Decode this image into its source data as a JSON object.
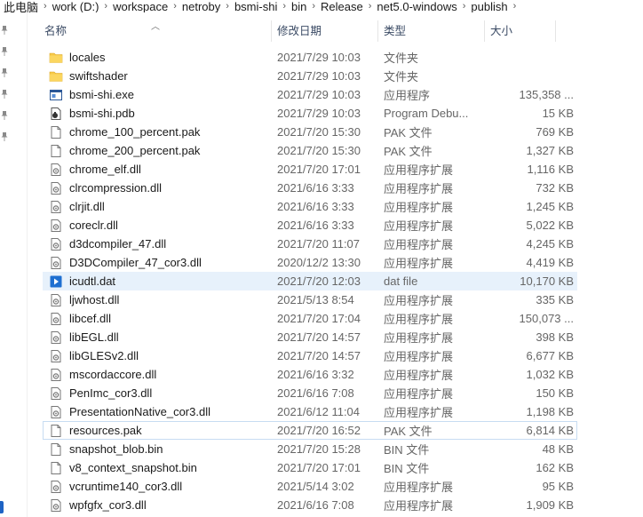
{
  "breadcrumb": [
    "此电脑",
    "work (D:)",
    "workspace",
    "netroby",
    "bsmi-shi",
    "bin",
    "Release",
    "net5.0-windows",
    "publish"
  ],
  "columns": {
    "name": "名称",
    "date": "修改日期",
    "type": "类型",
    "size": "大小"
  },
  "files": [
    {
      "name": "locales",
      "date": "2021/7/29 10:03",
      "type": "文件夹",
      "size": "",
      "icon": "folder-icon"
    },
    {
      "name": "swiftshader",
      "date": "2021/7/29 10:03",
      "type": "文件夹",
      "size": "",
      "icon": "folder-icon"
    },
    {
      "name": "bsmi-shi.exe",
      "date": "2021/7/29 10:03",
      "type": "应用程序",
      "size": "135,358 ...",
      "icon": "exe-icon"
    },
    {
      "name": "bsmi-shi.pdb",
      "date": "2021/7/29 10:03",
      "type": "Program Debu...",
      "size": "15 KB",
      "icon": "pdb-icon"
    },
    {
      "name": "chrome_100_percent.pak",
      "date": "2021/7/20 15:30",
      "type": "PAK 文件",
      "size": "769 KB",
      "icon": "file-icon"
    },
    {
      "name": "chrome_200_percent.pak",
      "date": "2021/7/20 15:30",
      "type": "PAK 文件",
      "size": "1,327 KB",
      "icon": "file-icon"
    },
    {
      "name": "chrome_elf.dll",
      "date": "2021/7/20 17:01",
      "type": "应用程序扩展",
      "size": "1,116 KB",
      "icon": "dll-icon"
    },
    {
      "name": "clrcompression.dll",
      "date": "2021/6/16 3:33",
      "type": "应用程序扩展",
      "size": "732 KB",
      "icon": "dll-icon"
    },
    {
      "name": "clrjit.dll",
      "date": "2021/6/16 3:33",
      "type": "应用程序扩展",
      "size": "1,245 KB",
      "icon": "dll-icon"
    },
    {
      "name": "coreclr.dll",
      "date": "2021/6/16 3:33",
      "type": "应用程序扩展",
      "size": "5,022 KB",
      "icon": "dll-icon"
    },
    {
      "name": "d3dcompiler_47.dll",
      "date": "2021/7/20 11:07",
      "type": "应用程序扩展",
      "size": "4,245 KB",
      "icon": "dll-icon"
    },
    {
      "name": "D3DCompiler_47_cor3.dll",
      "date": "2020/12/2 13:30",
      "type": "应用程序扩展",
      "size": "4,419 KB",
      "icon": "dll-icon"
    },
    {
      "name": "icudtl.dat",
      "date": "2021/7/20 12:03",
      "type": "dat file",
      "size": "10,170 KB",
      "icon": "dat-icon",
      "selected": true
    },
    {
      "name": "ljwhost.dll",
      "date": "2021/5/13 8:54",
      "type": "应用程序扩展",
      "size": "335 KB",
      "icon": "dll-icon"
    },
    {
      "name": "libcef.dll",
      "date": "2021/7/20 17:04",
      "type": "应用程序扩展",
      "size": "150,073 ...",
      "icon": "dll-icon"
    },
    {
      "name": "libEGL.dll",
      "date": "2021/7/20 14:57",
      "type": "应用程序扩展",
      "size": "398 KB",
      "icon": "dll-icon"
    },
    {
      "name": "libGLESv2.dll",
      "date": "2021/7/20 14:57",
      "type": "应用程序扩展",
      "size": "6,677 KB",
      "icon": "dll-icon"
    },
    {
      "name": "mscordaccore.dll",
      "date": "2021/6/16 3:32",
      "type": "应用程序扩展",
      "size": "1,032 KB",
      "icon": "dll-icon"
    },
    {
      "name": "PenImc_cor3.dll",
      "date": "2021/6/16 7:08",
      "type": "应用程序扩展",
      "size": "150 KB",
      "icon": "dll-icon"
    },
    {
      "name": "PresentationNative_cor3.dll",
      "date": "2021/6/12 11:04",
      "type": "应用程序扩展",
      "size": "1,198 KB",
      "icon": "dll-icon"
    },
    {
      "name": "resources.pak",
      "date": "2021/7/20 16:52",
      "type": "PAK 文件",
      "size": "6,814 KB",
      "icon": "file-icon",
      "outlined": true
    },
    {
      "name": "snapshot_blob.bin",
      "date": "2021/7/20 15:28",
      "type": "BIN 文件",
      "size": "48 KB",
      "icon": "file-icon"
    },
    {
      "name": "v8_context_snapshot.bin",
      "date": "2021/7/20 17:01",
      "type": "BIN 文件",
      "size": "162 KB",
      "icon": "file-icon"
    },
    {
      "name": "vcruntime140_cor3.dll",
      "date": "2021/5/14 3:02",
      "type": "应用程序扩展",
      "size": "95 KB",
      "icon": "dll-icon"
    },
    {
      "name": "wpfgfx_cor3.dll",
      "date": "2021/6/16 7:08",
      "type": "应用程序扩展",
      "size": "1,909 KB",
      "icon": "dll-icon"
    }
  ]
}
